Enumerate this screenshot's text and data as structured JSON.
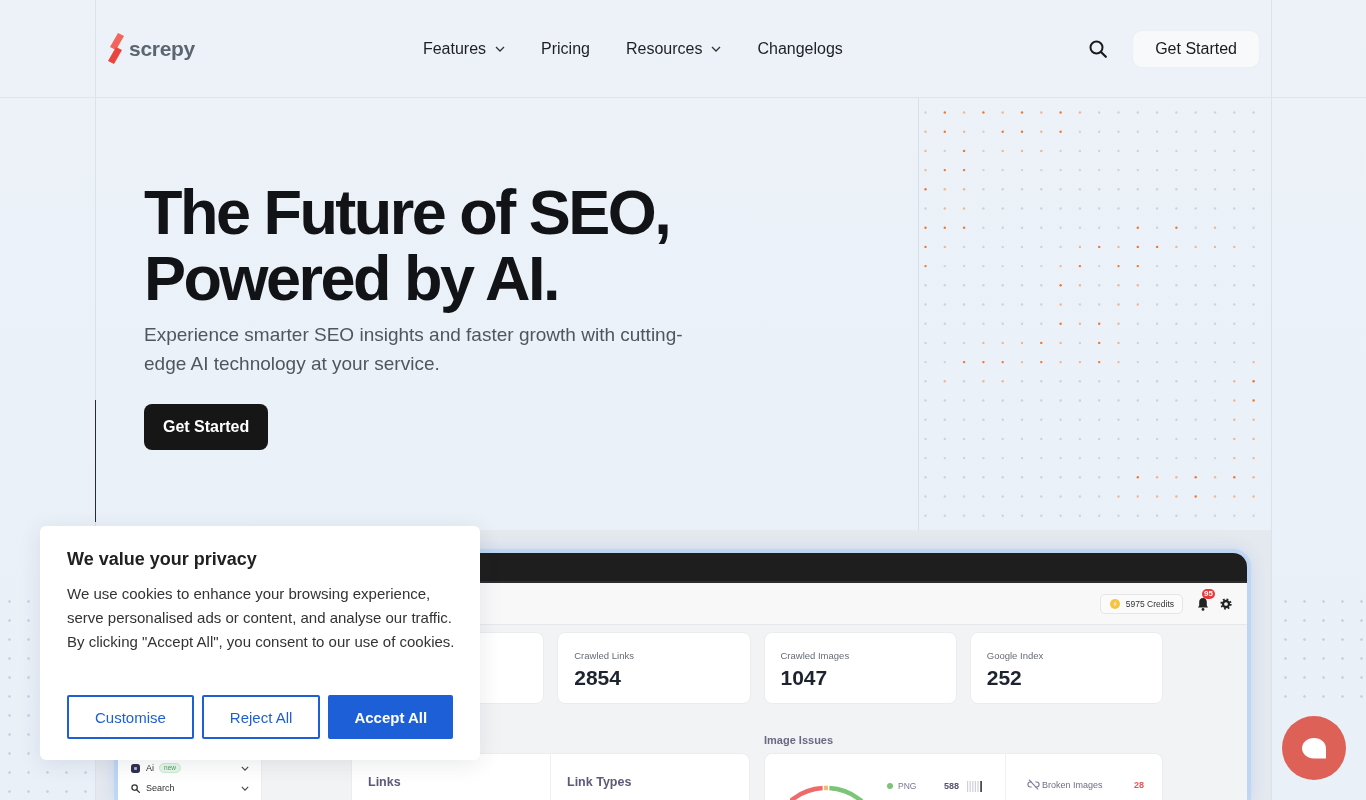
{
  "header": {
    "logo": "screpy",
    "nav": [
      {
        "label": "Features",
        "dropdown": true
      },
      {
        "label": "Pricing",
        "dropdown": false
      },
      {
        "label": "Resources",
        "dropdown": true
      },
      {
        "label": "Changelogs",
        "dropdown": false
      }
    ],
    "cta": "Get Started"
  },
  "hero": {
    "title": "The Future of SEO, Powered by AI.",
    "subtitle": "Experience smarter SEO insights and faster growth with cutting-edge AI technology at your service.",
    "cta": "Get Started"
  },
  "dashboard": {
    "sidebar": [
      {
        "label": "Ai",
        "badge": "new"
      },
      {
        "label": "Search"
      }
    ],
    "credits": "5975 Credits",
    "notifications": "95",
    "stats": [
      {
        "label": "Crawled Links",
        "value": "2854"
      },
      {
        "label": "Crawled Images",
        "value": "1047"
      },
      {
        "label": "Google Index",
        "value": "252"
      }
    ],
    "link_panels": [
      "Links",
      "Link Types"
    ],
    "image_issues": {
      "title": "Image Issues",
      "legend": [
        {
          "label": "PNG",
          "value": "588",
          "color": "#7cc576"
        }
      ],
      "issues": [
        {
          "label": "Broken Images",
          "count": "28"
        }
      ]
    }
  },
  "cookie_banner": {
    "title": "We value your privacy",
    "text": "We use cookies to enhance your browsing experience, serve personalised ads or content, and analyse our traffic. By clicking \"Accept All\", you consent to our use of cookies.",
    "buttons": [
      {
        "label": "Customise",
        "kind": "outline"
      },
      {
        "label": "Reject All",
        "kind": "outline"
      },
      {
        "label": "Accept All",
        "kind": "primary"
      }
    ]
  }
}
